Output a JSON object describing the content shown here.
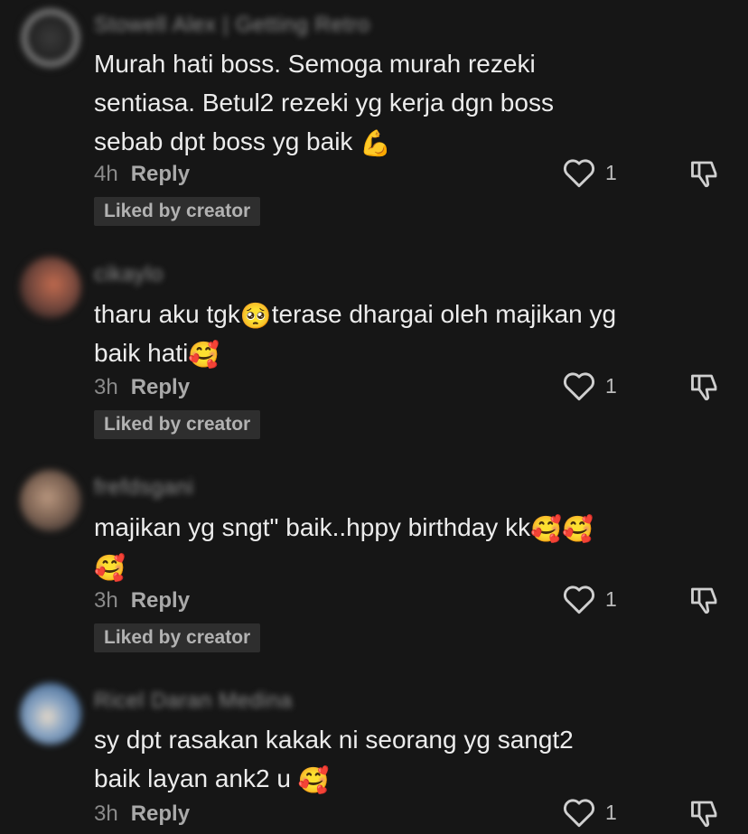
{
  "comments": [
    {
      "username": "Stowell Alex | Getting Retro",
      "lines": [
        "Murah hati boss. Semoga murah rezeki",
        "sentiasa. Betul2 rezeki yg kerja dgn boss",
        "sebab dpt boss yg baik"
      ],
      "emoji": "💪",
      "time": "4h",
      "reply_label": "Reply",
      "like_count": "1",
      "liked_badge": "Liked by creator"
    },
    {
      "username": "cikaylo",
      "lines": [
        "tharu aku tgk",
        "terase dhargai oleh majikan yg",
        "baik hati"
      ],
      "emojis": [
        "🥺",
        "🥰"
      ],
      "time": "3h",
      "reply_label": "Reply",
      "like_count": "1",
      "liked_badge": "Liked by creator"
    },
    {
      "username": "frefdsgani",
      "lines": [
        "majikan yg sngt\" baik..hppy birthday kk"
      ],
      "emojis": [
        "🥰",
        "🥰",
        "🥰"
      ],
      "time": "3h",
      "reply_label": "Reply",
      "like_count": "1",
      "liked_badge": "Liked by creator"
    },
    {
      "username": "Ricel Daran Medina",
      "lines": [
        "sy dpt rasakan kakak ni seorang yg sangt2",
        "baik layan ank2 u"
      ],
      "emoji": "🥰",
      "time": "3h",
      "reply_label": "Reply",
      "like_count": "1"
    }
  ],
  "colors": {
    "background": "#161616",
    "text": "#ececec",
    "muted": "#8a8a8a",
    "badge_bg": "#2e2e2e"
  },
  "icons": {
    "like": "heart-outline-icon",
    "dislike": "thumbs-down-outline-icon"
  }
}
